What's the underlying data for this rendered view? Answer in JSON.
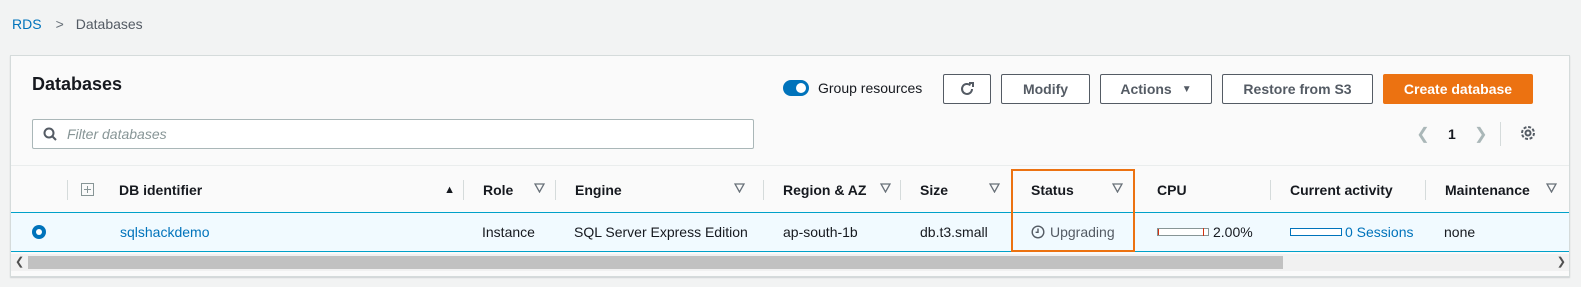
{
  "breadcrumb": {
    "root": "RDS",
    "separator": ">",
    "current": "Databases"
  },
  "panel": {
    "title": "Databases",
    "group_resources_label": "Group resources",
    "group_resources_on": true,
    "buttons": {
      "modify": "Modify",
      "actions": "Actions",
      "restore": "Restore from S3",
      "create": "Create database"
    },
    "search_placeholder": "Filter databases",
    "page": "1"
  },
  "table": {
    "columns": [
      "DB identifier",
      "Role",
      "Engine",
      "Region & AZ",
      "Size",
      "Status",
      "CPU",
      "Current activity",
      "Maintenance"
    ],
    "rows": [
      {
        "selected": true,
        "db_identifier": "sqlshackdemo",
        "role": "Instance",
        "engine": "SQL Server Express Edition",
        "region_az": "ap-south-1b",
        "size": "db.t3.small",
        "status": "Upgrading",
        "cpu": "2.00%",
        "cpu_fraction": 0.02,
        "current_activity": "0 Sessions",
        "maintenance": "none"
      }
    ]
  },
  "colors": {
    "accent": "#ec7211",
    "link": "#0073bb",
    "selected_row": "#f1faff",
    "selected_border": "#00a1c9"
  },
  "icons": [
    "search-icon",
    "refresh-icon",
    "caret-down-icon",
    "chevron-left-icon",
    "chevron-right-icon",
    "gear-icon",
    "expand-icon",
    "sort-ascending-icon",
    "filter-icon",
    "clock-icon",
    "radio-selected-icon"
  ]
}
